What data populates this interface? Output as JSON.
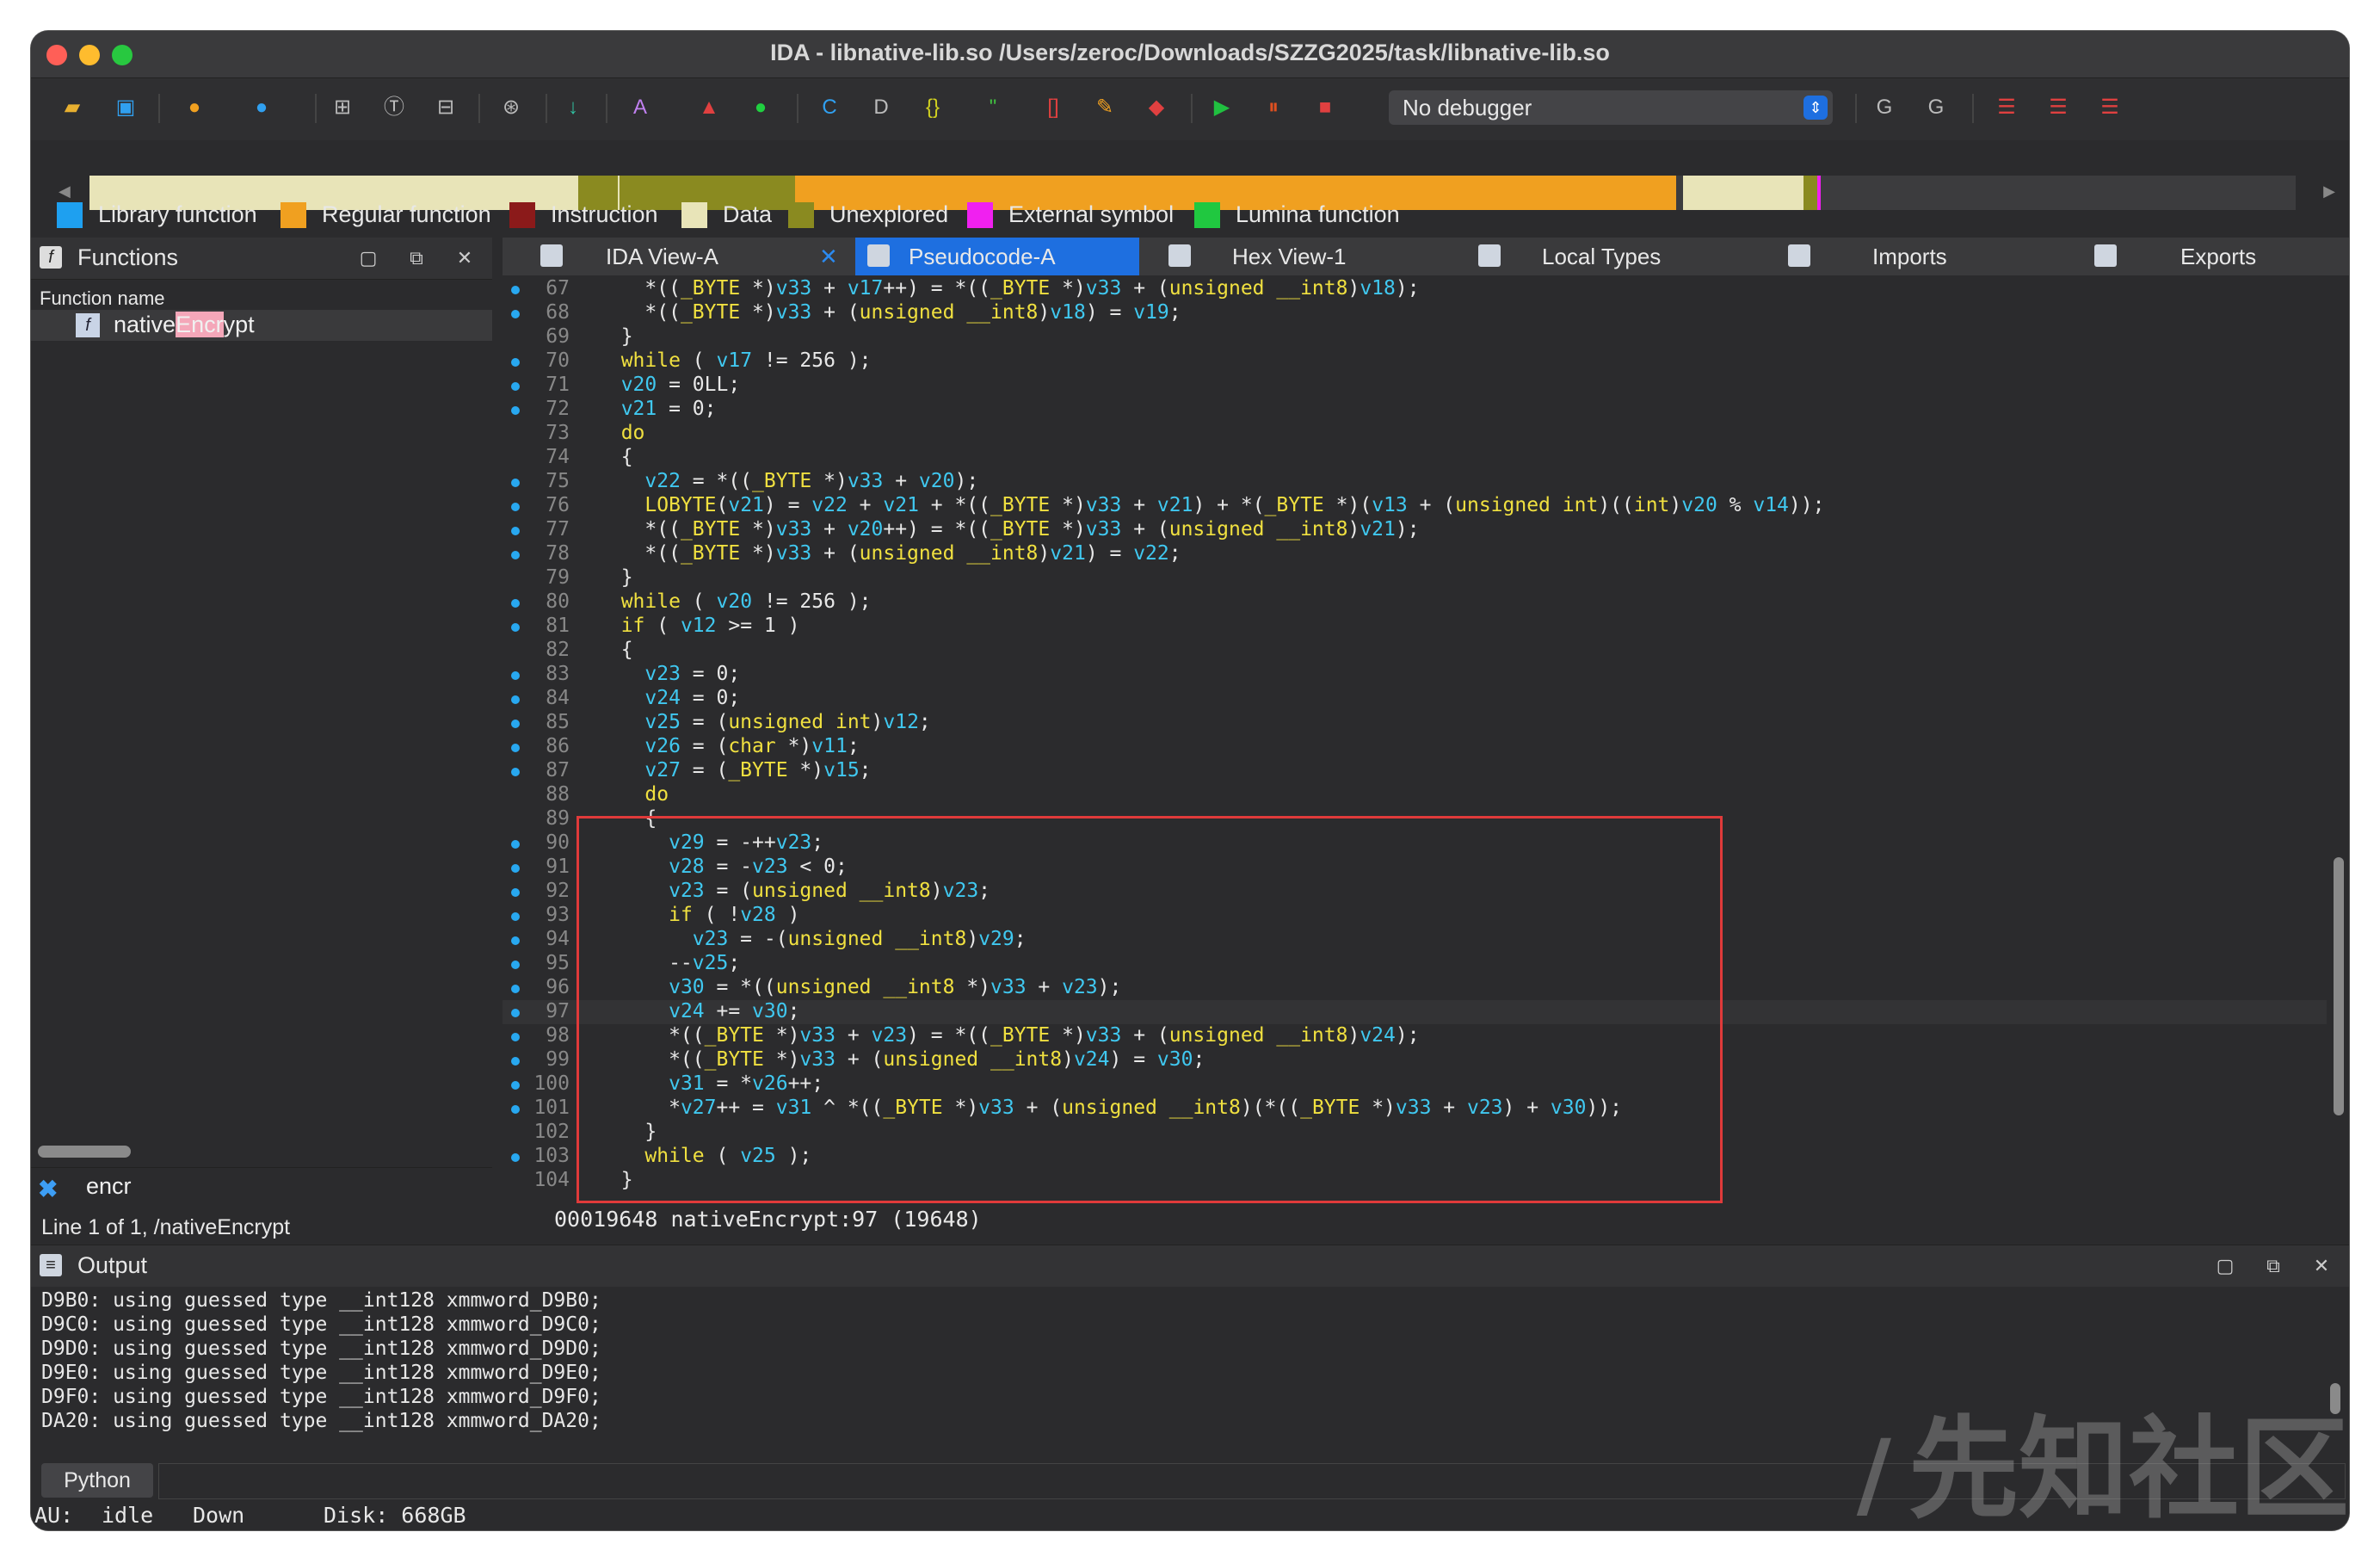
{
  "window": {
    "title": "IDA - libnative-lib.so /Users/zeroc/Downloads/SZZG2025/task/libnative-lib.so"
  },
  "toolbar": {
    "debugger_select": "No debugger",
    "icons": [
      "open-icon",
      "save-icon",
      "jump-back-icon",
      "jump-forward-icon",
      "new-segment-icon",
      "text-icon",
      "hex-icon",
      "structure-icon",
      "jump-icon",
      "a-icon",
      "picture-icon",
      "green-circle-icon",
      "code-icon",
      "data-icon",
      "undefine-icon",
      "array-icon",
      "name-icon",
      "patch-icon",
      "breakpoint-icon",
      "run-icon",
      "pause-icon",
      "stop-icon",
      "graph-icon",
      "refresh-icon",
      "list-icon",
      "list-add-icon",
      "list-remove-icon"
    ]
  },
  "legend": [
    {
      "label": "Library function",
      "color": "#1ea0f0"
    },
    {
      "label": "Regular function",
      "color": "#f0a020"
    },
    {
      "label": "Instruction",
      "color": "#8b1a1a"
    },
    {
      "label": "Data",
      "color": "#e8e4b8"
    },
    {
      "label": "Unexplored",
      "color": "#8a8a20"
    },
    {
      "label": "External symbol",
      "color": "#f020f0"
    },
    {
      "label": "Lumina function",
      "color": "#20c840"
    }
  ],
  "functions_panel": {
    "title": "Functions",
    "column_header": "Function name",
    "selected_pre": "native",
    "selected_highlight": "Encr",
    "selected_post": "ypt",
    "search_text": "encr",
    "line_status": "Line 1 of 1, /nativeEncrypt"
  },
  "tabs": [
    {
      "label": "IDA View-A"
    },
    {
      "label": "Pseudocode-A"
    },
    {
      "label": "Hex View-1"
    },
    {
      "label": "Local Types"
    },
    {
      "label": "Imports"
    },
    {
      "label": "Exports"
    }
  ],
  "code_lines": [
    {
      "n": "67",
      "bp": true,
      "t": "  *((_BYTE *)v33 + v17++) = *((_BYTE *)v33 + (unsigned __int8)v18);"
    },
    {
      "n": "68",
      "bp": true,
      "t": "  *((_BYTE *)v33 + (unsigned __int8)v18) = v19;"
    },
    {
      "n": "69",
      "bp": false,
      "t": "}"
    },
    {
      "n": "70",
      "bp": true,
      "t": "while ( v17 != 256 );"
    },
    {
      "n": "71",
      "bp": true,
      "t": "v20 = 0LL;"
    },
    {
      "n": "72",
      "bp": true,
      "t": "v21 = 0;"
    },
    {
      "n": "73",
      "bp": false,
      "t": "do"
    },
    {
      "n": "74",
      "bp": false,
      "t": "{"
    },
    {
      "n": "75",
      "bp": true,
      "t": "  v22 = *((_BYTE *)v33 + v20);"
    },
    {
      "n": "76",
      "bp": true,
      "t": "  LOBYTE(v21) = v22 + v21 + *((_BYTE *)v33 + v21) + *(_BYTE *)(v13 + (unsigned int)((int)v20 % v14));"
    },
    {
      "n": "77",
      "bp": true,
      "t": "  *((_BYTE *)v33 + v20++) = *((_BYTE *)v33 + (unsigned __int8)v21);"
    },
    {
      "n": "78",
      "bp": true,
      "t": "  *((_BYTE *)v33 + (unsigned __int8)v21) = v22;"
    },
    {
      "n": "79",
      "bp": false,
      "t": "}"
    },
    {
      "n": "80",
      "bp": true,
      "t": "while ( v20 != 256 );"
    },
    {
      "n": "81",
      "bp": true,
      "t": "if ( v12 >= 1 )"
    },
    {
      "n": "82",
      "bp": false,
      "t": "{"
    },
    {
      "n": "83",
      "bp": true,
      "t": "  v23 = 0;"
    },
    {
      "n": "84",
      "bp": true,
      "t": "  v24 = 0;"
    },
    {
      "n": "85",
      "bp": true,
      "t": "  v25 = (unsigned int)v12;"
    },
    {
      "n": "86",
      "bp": true,
      "t": "  v26 = (char *)v11;"
    },
    {
      "n": "87",
      "bp": true,
      "t": "  v27 = (_BYTE *)v15;"
    },
    {
      "n": "88",
      "bp": false,
      "t": "  do"
    },
    {
      "n": "89",
      "bp": false,
      "t": "  {"
    },
    {
      "n": "90",
      "bp": true,
      "t": "    v29 = -++v23;"
    },
    {
      "n": "91",
      "bp": true,
      "t": "    v28 = -v23 < 0;"
    },
    {
      "n": "92",
      "bp": true,
      "t": "    v23 = (unsigned __int8)v23;"
    },
    {
      "n": "93",
      "bp": true,
      "t": "    if ( !v28 )"
    },
    {
      "n": "94",
      "bp": true,
      "t": "      v23 = -(unsigned __int8)v29;"
    },
    {
      "n": "95",
      "bp": true,
      "t": "    --v25;"
    },
    {
      "n": "96",
      "bp": true,
      "t": "    v30 = *((unsigned __int8 *)v33 + v23);"
    },
    {
      "n": "97",
      "bp": true,
      "t": "    v24 += v30;"
    },
    {
      "n": "98",
      "bp": true,
      "t": "    *((_BYTE *)v33 + v23) = *((_BYTE *)v33 + (unsigned __int8)v24);"
    },
    {
      "n": "99",
      "bp": true,
      "t": "    *((_BYTE *)v33 + (unsigned __int8)v24) = v30;"
    },
    {
      "n": "100",
      "bp": true,
      "t": "    v31 = *v26++;"
    },
    {
      "n": "101",
      "bp": true,
      "t": "    *v27++ = v31 ^ *((_BYTE *)v33 + (unsigned __int8)(*((_BYTE *)v33 + v23) + v30));"
    },
    {
      "n": "102",
      "bp": false,
      "t": "  }"
    },
    {
      "n": "103",
      "bp": true,
      "t": "  while ( v25 );"
    },
    {
      "n": "104",
      "bp": false,
      "t": "}"
    }
  ],
  "code_status": "00019648 nativeEncrypt:97 (19648)",
  "output": {
    "title": "Output",
    "lines": [
      "D9B0: using guessed type __int128 xmmword_D9B0;",
      "D9C0: using guessed type __int128 xmmword_D9C0;",
      "D9D0: using guessed type __int128 xmmword_D9D0;",
      "D9E0: using guessed type __int128 xmmword_D9E0;",
      "D9F0: using guessed type __int128 xmmword_D9F0;",
      "DA20: using guessed type __int128 xmmword_DA20;"
    ],
    "python_label": "Python"
  },
  "statusbar": {
    "au_label": "AU:",
    "au_state": "idle",
    "direction": "Down",
    "disk": "Disk: 668GB"
  },
  "watermark": "先知社区"
}
